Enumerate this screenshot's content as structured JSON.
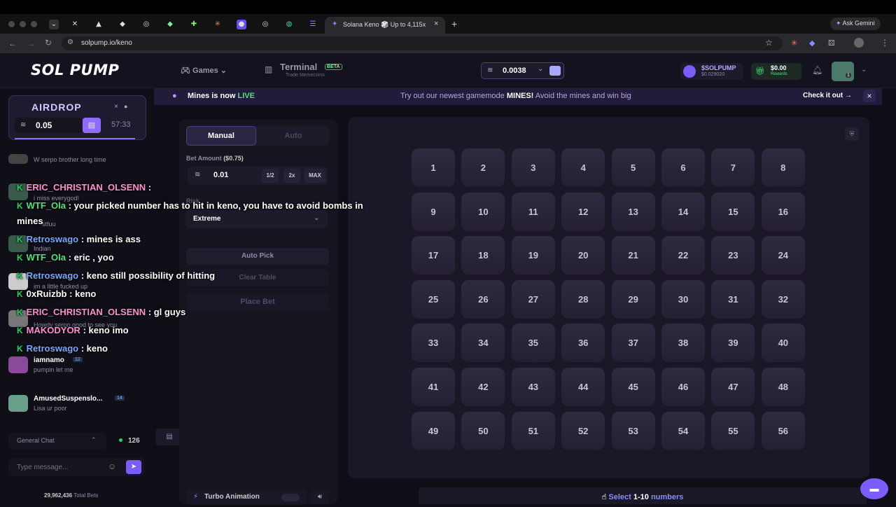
{
  "browser": {
    "active_tab_title": "Solana Keno 🎲 Up to 4,115x",
    "url": "solpump.io/keno",
    "ask_gemini": "Ask Gemini",
    "new_tab": "+"
  },
  "header": {
    "logo": "SOL PUMP",
    "games_label": "Games",
    "terminal_label": "Terminal",
    "terminal_badge": "BETA",
    "terminal_sub": "Trade Memecoins",
    "balance": "0.0038",
    "solpump_label": "$SOLPUMP",
    "solpump_price": "$0.029020",
    "rewards_amount": "$0.00",
    "rewards_label": "Rewards",
    "avatar_badge": "1"
  },
  "banner": {
    "left_text": "Mines is now ",
    "live": "LIVE",
    "mid_text_a": "Try out our newest gamemode ",
    "mid_bold": "MINES!",
    "mid_text_b": " Avoid the mines and win big",
    "cta": "Check it out →",
    "close": "×"
  },
  "sidebar": {
    "airdrop_title": "AIRDROP",
    "airdrop_amount": "0.05",
    "airdrop_timer": "57:33",
    "chat_items": [
      {
        "name": "",
        "level": "",
        "msg": "W serpo brother long time"
      },
      {
        "name": "",
        "level": "",
        "msg": "i miss everygod!"
      },
      {
        "name": "",
        "level": "",
        "msg": "stfuu"
      },
      {
        "name": "",
        "level": "",
        "msg": "Indian"
      },
      {
        "name": "",
        "level": "",
        "msg": "im a little fucked up"
      },
      {
        "name": "",
        "level": "",
        "msg": "Howdy serpo good to see you"
      },
      {
        "name": "iamnamo",
        "level": "12",
        "msg": "pumpin let me"
      },
      {
        "name": "AmusedSuspenslo...",
        "level": "14",
        "msg": "Lisa ur poor"
      }
    ],
    "chat_channel": "General Chat",
    "online_count": "126",
    "input_placeholder": "Type message...",
    "total_bets_value": "29,962,436",
    "total_bets_label": "Total Bets"
  },
  "overlay_chat": [
    {
      "user": "ERIC_CHRISTIAN_OLSENN",
      "text": " : ",
      "user_color": "#ff8fd0"
    },
    {
      "user": "WTF_Ola",
      "text": " : your picked number has to hit in keno, you have to avoid bombs in",
      "user_color": "#4ee37a"
    },
    {
      "user": "",
      "text": "mines",
      "user_color": "#ffffff"
    },
    {
      "user": "Retroswago",
      "text": " : mines is ass",
      "user_color": "#7aa7ff"
    },
    {
      "user": "WTF_Ola",
      "text": " : eric , yoo",
      "user_color": "#4ee37a"
    },
    {
      "user": "Retroswago",
      "text": " : keno still possibility of hitting",
      "user_color": "#7aa7ff"
    },
    {
      "user": "0xRuizbb",
      "text": " : keno",
      "user_color": "#ffffff"
    },
    {
      "user": "ERIC_CHRISTIAN_OLSENN",
      "text": " : gl guys",
      "user_color": "#ff8fd0"
    },
    {
      "user": "MAKODYOR",
      "text": " : keno imo",
      "user_color": "#ff8fd0"
    },
    {
      "user": "Retroswago",
      "text": " : keno",
      "user_color": "#7aa7ff"
    }
  ],
  "panel": {
    "tab_manual": "Manual",
    "tab_auto": "Auto",
    "bet_amount_label": "Bet Amount",
    "bet_amount_usd": "($0.75)",
    "bet_value": "0.01",
    "half": "1/2",
    "double": "2x",
    "max": "MAX",
    "risk_label": "Risk",
    "risk_value": "Extreme",
    "auto_pick": "Auto Pick",
    "clear_table": "Clear Table",
    "place_bet": "Place Bet",
    "turbo": "Turbo Animation"
  },
  "board": {
    "numbers": [
      "1",
      "2",
      "3",
      "4",
      "5",
      "6",
      "7",
      "8",
      "9",
      "10",
      "11",
      "12",
      "13",
      "14",
      "15",
      "16",
      "17",
      "18",
      "19",
      "20",
      "21",
      "22",
      "23",
      "24",
      "25",
      "26",
      "27",
      "28",
      "29",
      "30",
      "31",
      "32",
      "33",
      "34",
      "35",
      "36",
      "37",
      "38",
      "39",
      "40",
      "41",
      "42",
      "43",
      "44",
      "45",
      "46",
      "47",
      "48",
      "49",
      "50",
      "51",
      "52",
      "53",
      "54",
      "55",
      "56"
    ],
    "footer_select": "Select",
    "footer_range": "1-10",
    "footer_numbers": "numbers"
  }
}
